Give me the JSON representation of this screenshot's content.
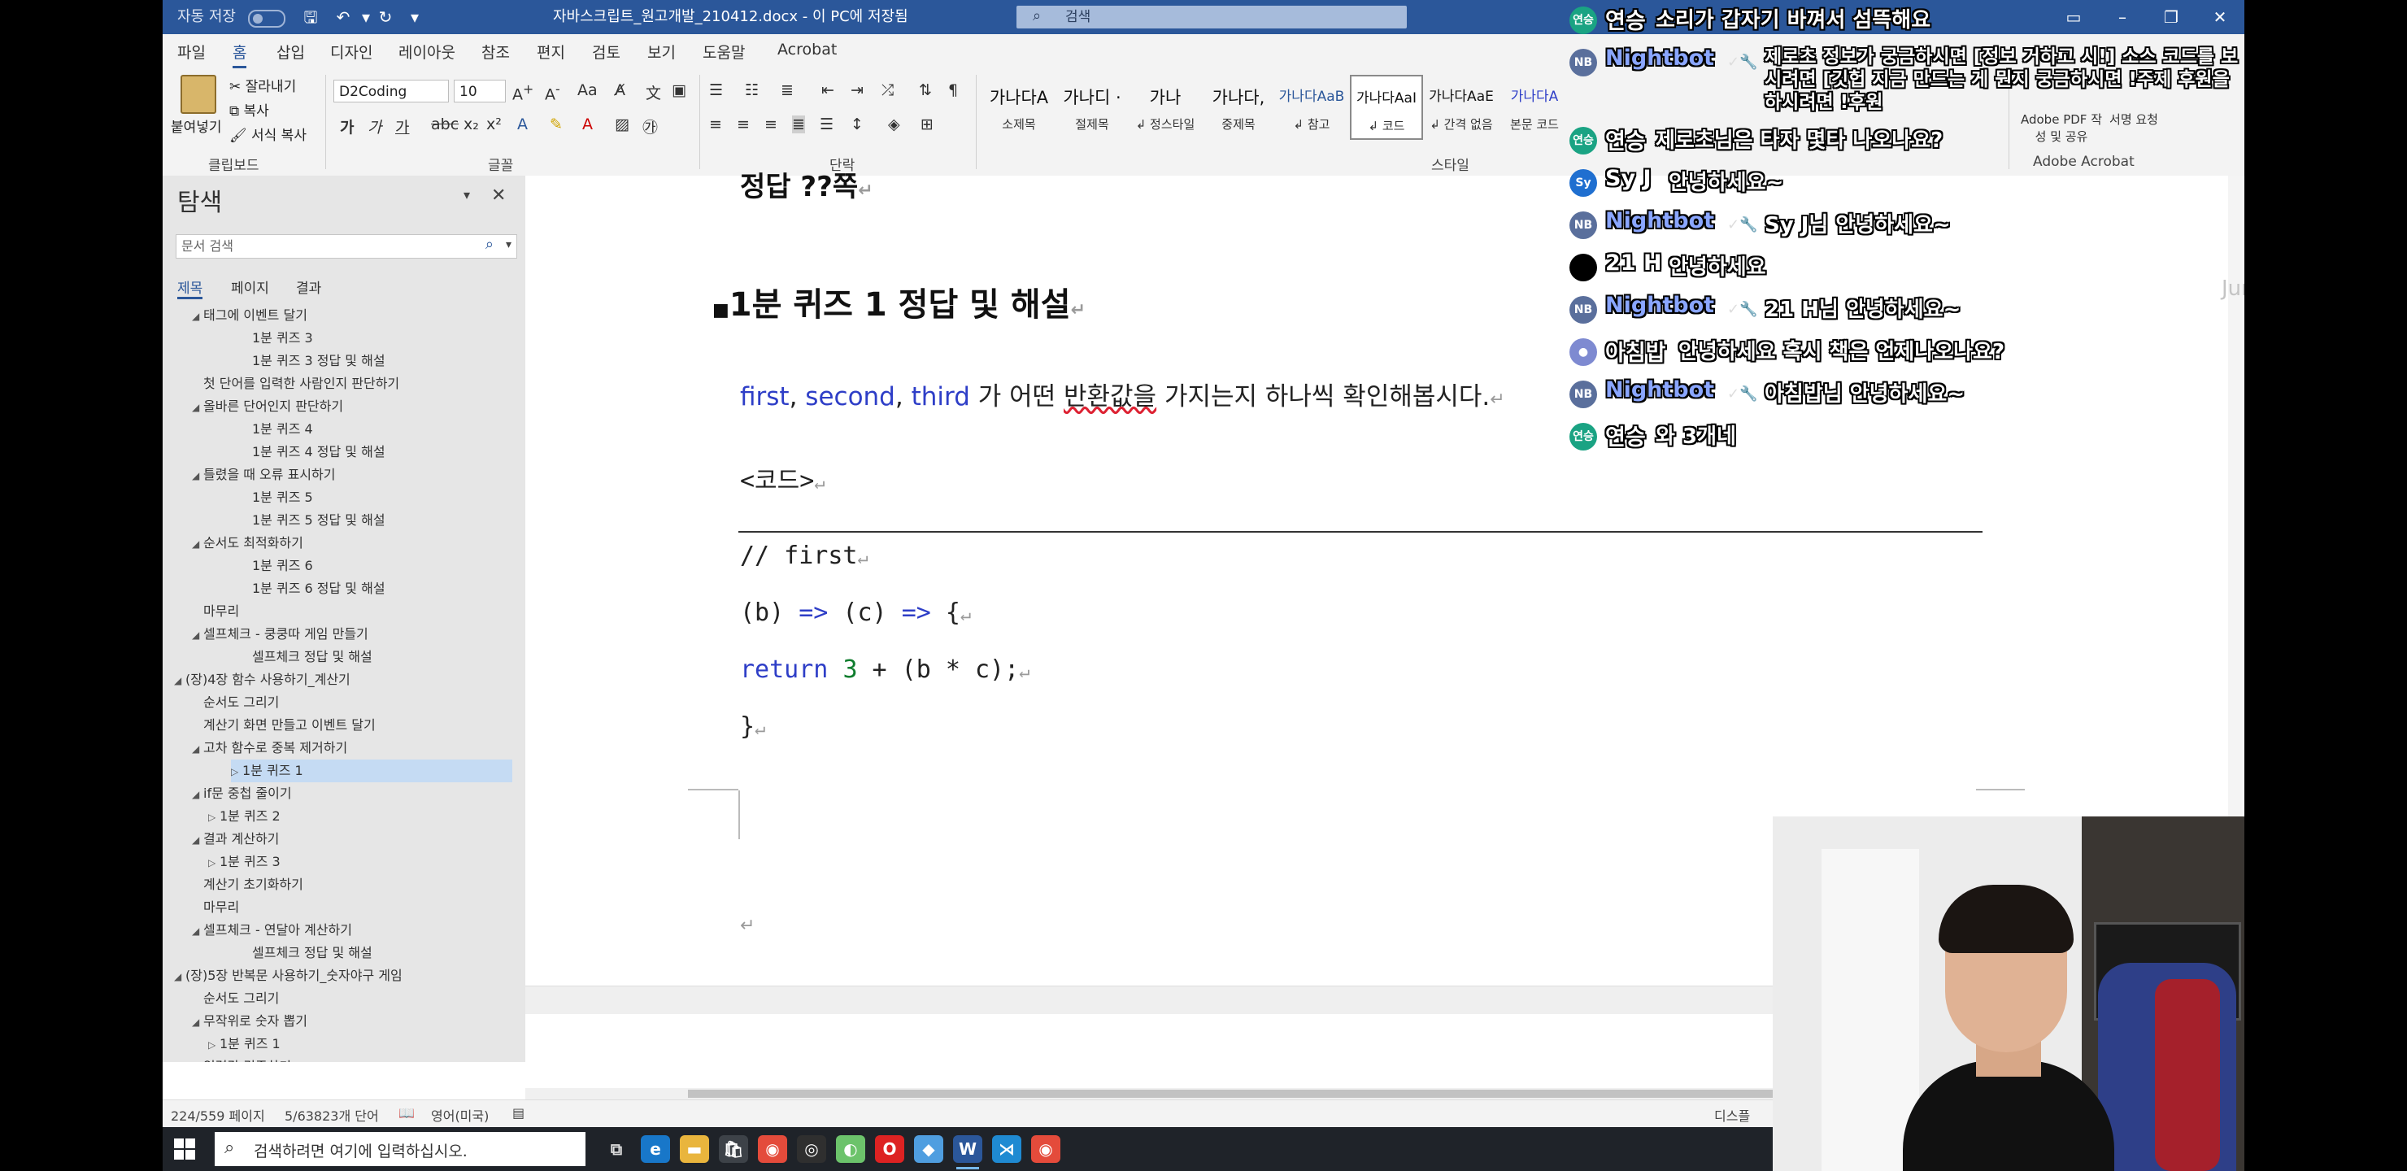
{
  "titlebar": {
    "autosave_label": "자동 저장",
    "doc_title": "자바스크립트_원고개발_210412.docx  -  이 PC에 저장됨",
    "search_placeholder": "검색"
  },
  "tabs": [
    "파일",
    "홈",
    "삽입",
    "디자인",
    "레이아웃",
    "참조",
    "편지",
    "검토",
    "보기",
    "도움말",
    "Acrobat"
  ],
  "active_tab": "홈",
  "ribbon": {
    "clipboard": {
      "paste": "붙여넣기",
      "cut": "잘라내기",
      "copy": "복사",
      "format_painter": "서식 복사",
      "label": "클립보드"
    },
    "font": {
      "name": "D2Coding",
      "size": "10",
      "label": "글꼴"
    },
    "paragraph": {
      "label": "단락"
    },
    "styles": {
      "label": "스타일",
      "items": [
        {
          "sample": "가나다A",
          "name": "소제목"
        },
        {
          "sample": "가나디 ·",
          "name": "절제목"
        },
        {
          "sample": "가나",
          "name": "↲ 정스타일"
        },
        {
          "sample": "가나다,",
          "name": "중제목"
        },
        {
          "sample": "가나다AaB",
          "name": "↲ 참고"
        },
        {
          "sample": "가나다AaI",
          "name": "↲ 코드"
        },
        {
          "sample": "가나다AaE",
          "name": "↲ 간격 없음"
        },
        {
          "sample": "가나다A",
          "name": "본문 코드"
        }
      ]
    },
    "adobe": {
      "create_pdf": "Adobe PDF 작성 및 공유",
      "sign": "서명 요청",
      "label": "Adobe Acrobat"
    }
  },
  "nav": {
    "title": "탐색",
    "search_placeholder": "문서 검색",
    "tabs": [
      "제목",
      "페이지",
      "결과"
    ],
    "items": [
      {
        "text": "태그에 이벤트 달기",
        "level": 2,
        "tri": "◢"
      },
      {
        "text": "1분 퀴즈 3",
        "level": 4,
        "tri": ""
      },
      {
        "text": "1분 퀴즈 3 정답 및 해설",
        "level": 4,
        "tri": ""
      },
      {
        "text": "첫 단어를 입력한 사람인지 판단하기",
        "level": 2,
        "tri": ""
      },
      {
        "text": "올바른 단어인지 판단하기",
        "level": 2,
        "tri": "◢"
      },
      {
        "text": "1분 퀴즈 4",
        "level": 4,
        "tri": ""
      },
      {
        "text": "1분 퀴즈 4 정답 및 해설",
        "level": 4,
        "tri": ""
      },
      {
        "text": "틀렸을 때 오류 표시하기",
        "level": 2,
        "tri": "◢"
      },
      {
        "text": "1분 퀴즈 5",
        "level": 4,
        "tri": ""
      },
      {
        "text": "1분 퀴즈 5 정답 및 해설",
        "level": 4,
        "tri": ""
      },
      {
        "text": "순서도 최적화하기",
        "level": 2,
        "tri": "◢"
      },
      {
        "text": "1분 퀴즈 6",
        "level": 4,
        "tri": ""
      },
      {
        "text": "1분 퀴즈 6 정답 및 해설",
        "level": 4,
        "tri": ""
      },
      {
        "text": "마무리",
        "level": 2,
        "tri": ""
      },
      {
        "text": "셀프체크 - 쿵쿵따 게임 만들기",
        "level": 2,
        "tri": "◢"
      },
      {
        "text": "셀프체크 정답 및 해설",
        "level": 4,
        "tri": ""
      },
      {
        "text": "(장)4장 함수 사용하기_계산기",
        "level": 1,
        "tri": "◢"
      },
      {
        "text": "순서도 그리기",
        "level": 2,
        "tri": ""
      },
      {
        "text": "계산기 화면 만들고 이벤트 달기",
        "level": 2,
        "tri": ""
      },
      {
        "text": "고차 함수로 중복 제거하기",
        "level": 2,
        "tri": "◢"
      },
      {
        "text": "1분 퀴즈 1",
        "level": 3,
        "tri": "▷",
        "selected": true
      },
      {
        "text": "if문 중첩 줄이기",
        "level": 2,
        "tri": "◢"
      },
      {
        "text": "1분 퀴즈 2",
        "level": 3,
        "tri": "▷"
      },
      {
        "text": "결과 계산하기",
        "level": 2,
        "tri": "◢"
      },
      {
        "text": "1분 퀴즈 3",
        "level": 3,
        "tri": "▷"
      },
      {
        "text": "계산기 초기화하기",
        "level": 2,
        "tri": ""
      },
      {
        "text": "마무리",
        "level": 2,
        "tri": ""
      },
      {
        "text": "셀프체크 - 연달아 계산하기",
        "level": 2,
        "tri": "◢"
      },
      {
        "text": "셀프체크 정답 및 해설",
        "level": 4,
        "tri": ""
      },
      {
        "text": "(장)5장 반복문 사용하기_숫자야구 게임",
        "level": 1,
        "tri": "◢"
      },
      {
        "text": "순서도 그리기",
        "level": 2,
        "tri": ""
      },
      {
        "text": "무작위로 숫자 뽑기",
        "level": 2,
        "tri": "◢"
      },
      {
        "text": "1분 퀴즈 1",
        "level": 3,
        "tri": "▷"
      },
      {
        "text": "입력값 검증하기",
        "level": 2,
        "tri": ""
      }
    ]
  },
  "doc": {
    "answer_heading": "정답 ??쪽",
    "quiz_heading": "1분 퀴즈 1 정답 및 해설",
    "intro_kw1": "first",
    "intro_kw2": "second",
    "intro_kw3": "third",
    "intro_rest1": " 가 어떤 ",
    "intro_underlined": "반환값을",
    "intro_rest2": " 가지는지 하나씩 확인해봅시다.",
    "code_label": "<코드>",
    "code_comment": "// first",
    "code_line2_a": "(b) ",
    "code_arrow": "=>",
    "code_line2_b": " (c) ",
    "code_line2_c": " {",
    "code_line3_a": "  return ",
    "code_line3_num": "3",
    "code_line3_b": " + (b * c);",
    "code_line4": "}",
    "pilcrow": "↵"
  },
  "status": {
    "page": "224/559 페이지",
    "words": "5/63823개 단어",
    "lang": "영어(미국)",
    "focus": "디스플"
  },
  "taskbar": {
    "search_placeholder": "검색하려면 여기에 입력하십시오."
  },
  "chat": [
    {
      "user": "연승",
      "badge": "",
      "text": "소리가 갑자기 바껴서 섬뜩해요",
      "avatar": "연승",
      "color": "#1aa383",
      "bot": false
    },
    {
      "user": "Nightbot",
      "badge": "✓🔧",
      "text": "제로초 정보가 궁금하시면 [정보 거하고 시!] 소스 코드를 보시려면 [깃헙 지금 만드는 게 뭔지 궁금하시면 !주제 후원을 하시려면 !후원",
      "avatar": "NB",
      "color": "#5a6f9c",
      "bot": true
    },
    {
      "user": "연승",
      "badge": "",
      "text": "제로초님은 타자 몇타 나오나요?",
      "avatar": "연승",
      "color": "#1aa383",
      "bot": false
    },
    {
      "user": "Sy J",
      "badge": "",
      "text": "안녕하세요~",
      "avatar": "Sy",
      "color": "#1f6fd0",
      "bot": false
    },
    {
      "user": "Nightbot",
      "badge": "✓🔧",
      "text": "Sy J님 안녕하세요~",
      "avatar": "NB",
      "color": "#5a6f9c",
      "bot": true
    },
    {
      "user": "21 H",
      "badge": "",
      "text": "안녕하세요",
      "avatar": "",
      "color": "#000000",
      "bot": false
    },
    {
      "user": "Nightbot",
      "badge": "✓🔧",
      "text": "21 H님 안녕하세요~",
      "avatar": "NB",
      "color": "#5a6f9c",
      "bot": true
    },
    {
      "user": "아침밥",
      "badge": "",
      "text": "안녕하세요 혹시 책은 언제나오나요?",
      "avatar": "●",
      "color": "#7e8ad1",
      "bot": false
    },
    {
      "user": "Nightbot",
      "badge": "✓🔧",
      "text": "아침밥님 안녕하세요~",
      "avatar": "NB",
      "color": "#5a6f9c",
      "bot": true
    },
    {
      "user": "연승",
      "badge": "",
      "text": "와 3개네",
      "avatar": "연승",
      "color": "#1aa383",
      "bot": false
    }
  ],
  "watermark": "Jung Jiyeo"
}
